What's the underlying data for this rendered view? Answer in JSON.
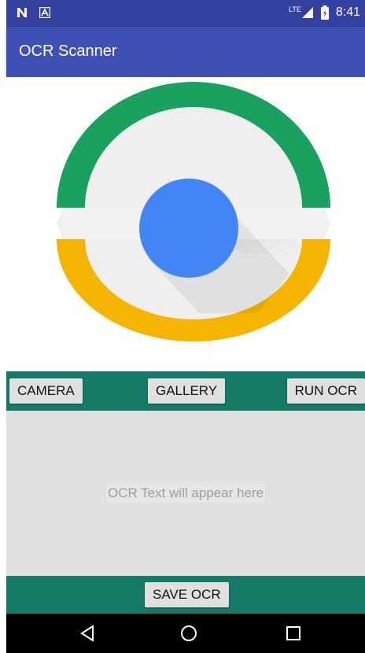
{
  "status_bar": {
    "time": "8:41",
    "network": "LTE",
    "icons": [
      "n-notification-icon",
      "a-notification-icon",
      "signal-icon",
      "battery-icon"
    ]
  },
  "app_bar": {
    "title": "OCR Scanner"
  },
  "logo": {
    "colors": {
      "green": "#1aa15f",
      "yellow": "#f4b400",
      "blue": "#4285f4",
      "band": "#f1f1f1"
    }
  },
  "controls": {
    "camera_label": "CAMERA",
    "gallery_label": "GALLERY",
    "run_ocr_label": "RUN OCR"
  },
  "ocr_output": {
    "placeholder": "OCR Text will appear here"
  },
  "save": {
    "label": "SAVE OCR"
  },
  "nav": {
    "icons": [
      "back-icon",
      "home-icon",
      "recents-icon"
    ]
  },
  "theme": {
    "primary": "#3f51b5",
    "primary_dark": "#3441a0",
    "accent_bar": "#157a66"
  }
}
